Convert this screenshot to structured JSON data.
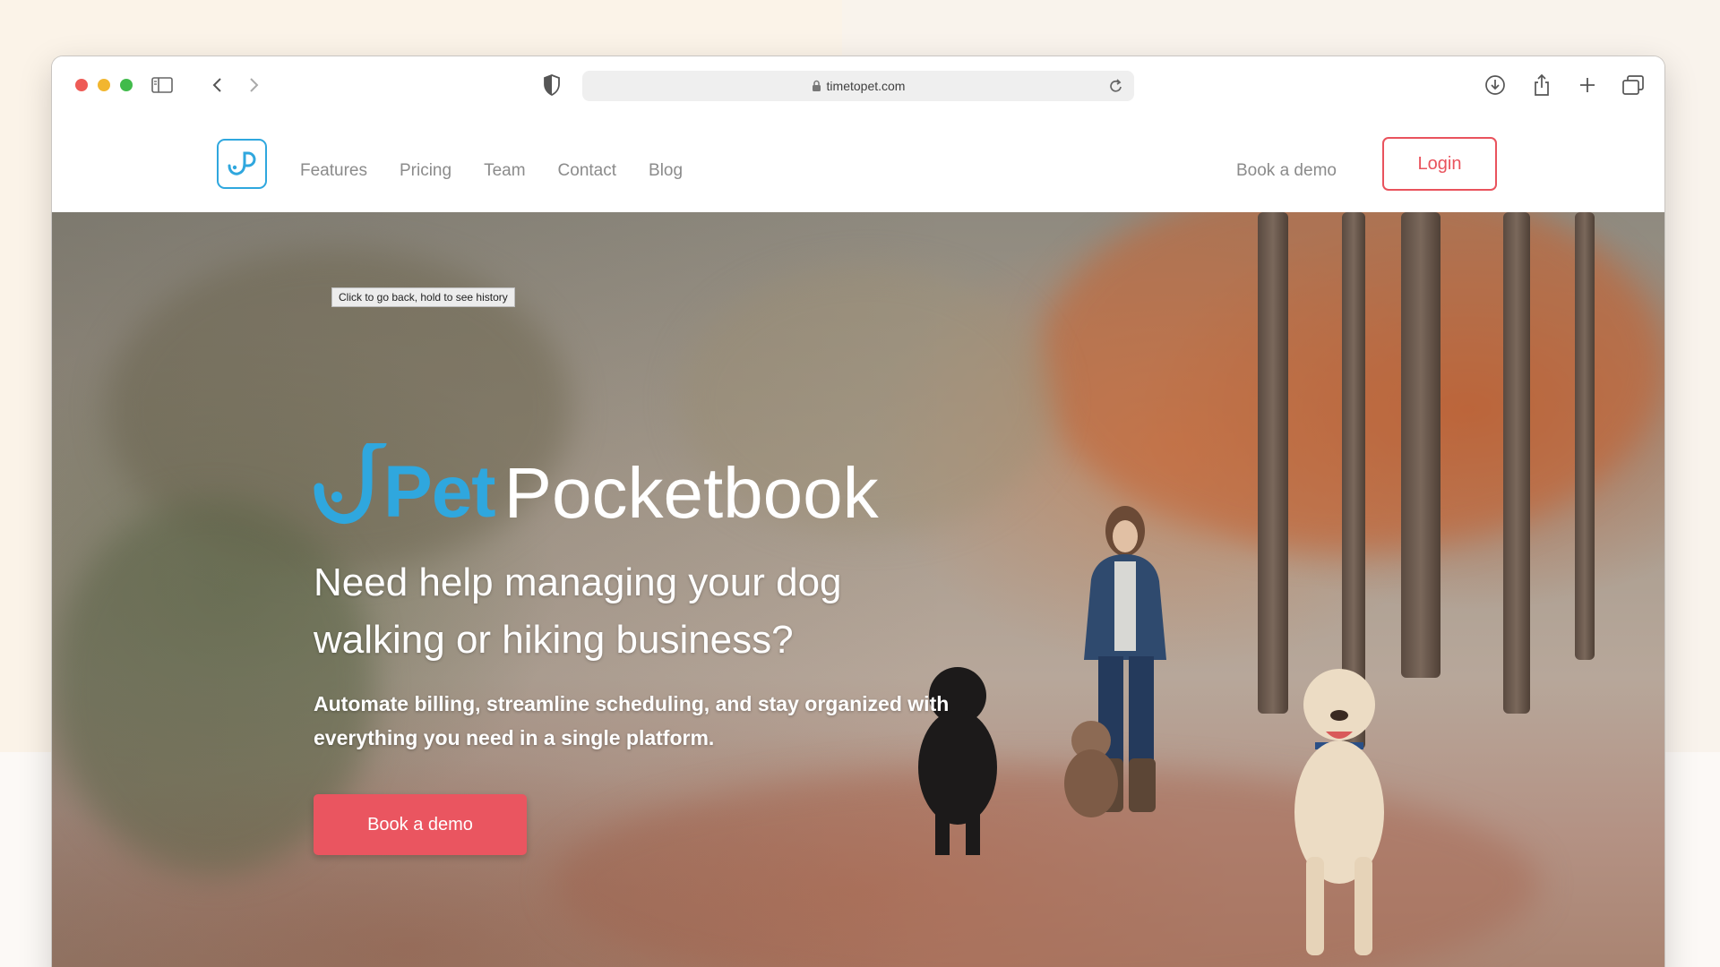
{
  "browser": {
    "url": "timetopet.com"
  },
  "nav": {
    "links": [
      "Features",
      "Pricing",
      "Team",
      "Contact",
      "Blog"
    ],
    "book_demo": "Book a demo",
    "login": "Login"
  },
  "tooltip": "Click to go back, hold to see history",
  "hero": {
    "brand_pet": "Pet",
    "brand_pocketbook": "Pocketbook",
    "headline": "Need help managing your dog walking or hiking business?",
    "subhead": "Automate billing, streamline scheduling, and stay organized with everything you need in a single platform.",
    "cta": "Book a demo"
  },
  "colors": {
    "brand_blue": "#2fa7de",
    "accent_red": "#ea5560",
    "nav_text": "#8b8b8b"
  },
  "icons": [
    "sidebar-toggle-icon",
    "back-arrow-icon",
    "forward-arrow-icon",
    "shield-icon",
    "lock-icon",
    "reload-icon",
    "download-icon",
    "share-icon",
    "new-tab-icon",
    "tab-overview-icon"
  ]
}
